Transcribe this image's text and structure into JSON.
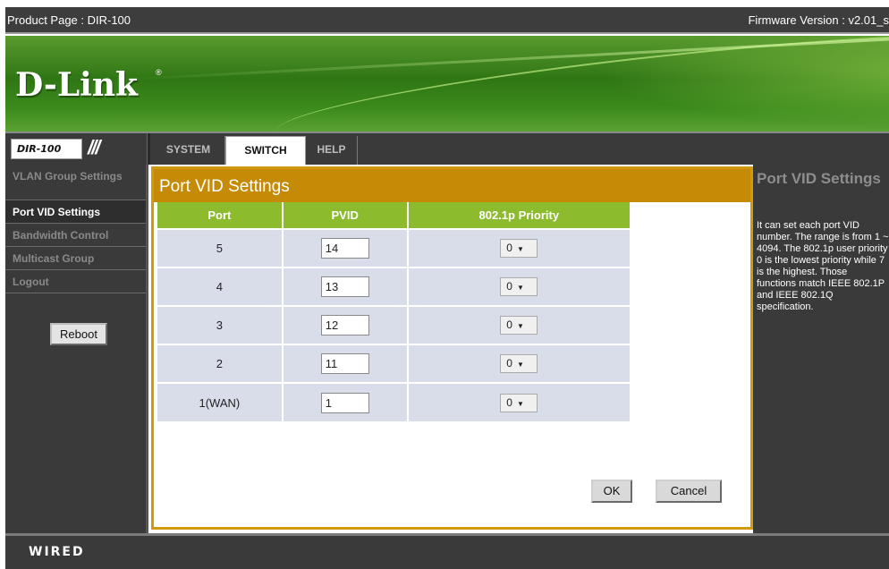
{
  "header": {
    "product_page": "Product Page : DIR-100",
    "firmware_version": "Firmware Version : v2.01_s"
  },
  "banner": {
    "logo": "D-Link",
    "logo_mark": "®"
  },
  "nav": {
    "model": "DIR-100",
    "slashes": "///",
    "tabs": [
      {
        "label": "SYSTEM",
        "active": false
      },
      {
        "label": "SWITCH",
        "active": true
      },
      {
        "label": "HELP",
        "active": false
      }
    ]
  },
  "sidebar": {
    "items": [
      {
        "label": "VLAN Group Settings"
      },
      {
        "label": "Port VID Settings"
      },
      {
        "label": "Bandwidth Control"
      },
      {
        "label": "Multicast Group"
      },
      {
        "label": "Logout"
      }
    ],
    "reboot_label": "Reboot"
  },
  "main": {
    "title": "Port VID Settings",
    "columns": [
      "Port",
      "PVID",
      "802.1p Priority"
    ],
    "rows": [
      {
        "port": "5",
        "pvid": "14",
        "priority": "0"
      },
      {
        "port": "4",
        "pvid": "13",
        "priority": "0"
      },
      {
        "port": "3",
        "pvid": "12",
        "priority": "0"
      },
      {
        "port": "2",
        "pvid": "11",
        "priority": "0"
      },
      {
        "port": "1(WAN)",
        "pvid": "1",
        "priority": "0"
      }
    ],
    "ok_label": "OK",
    "cancel_label": "Cancel"
  },
  "help": {
    "title": "Port VID Settings",
    "body": "It can set each port VID number. The range is from 1 ~ 4094. The 802.1p user priority 0 is the lowest priority while 7 is the highest. Those functions match IEEE 802.1P and IEEE 802.1Q specification."
  },
  "footer": {
    "brand": "WIRED"
  },
  "colors": {
    "accent": "#c58a06",
    "header_green": "#8cbb2e",
    "banner_green": "#2f7614",
    "row_bg": "#d9dce9"
  }
}
